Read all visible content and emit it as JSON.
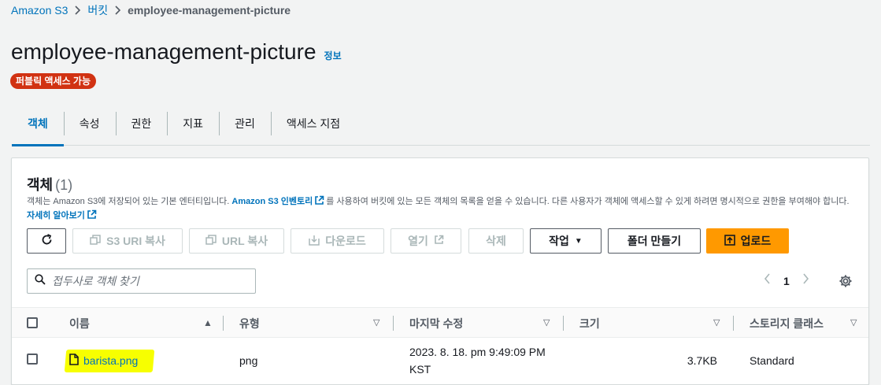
{
  "breadcrumb": {
    "items": [
      "Amazon S3",
      "버킷",
      "employee-management-picture"
    ]
  },
  "header": {
    "title": "employee-management-picture",
    "info_link": "정보",
    "badge": "퍼블릭 액세스 가능"
  },
  "tabs": [
    "객체",
    "속성",
    "권한",
    "지표",
    "관리",
    "액세스 지점"
  ],
  "objects": {
    "title": "객체",
    "count": "(1)",
    "description_1": "객체는 Amazon S3에 저장되어 있는 기본 엔터티입니다. ",
    "description_link_1": "Amazon S3 인벤토리",
    "description_2": "를 사용하여 버킷에 있는 모든 객체의 목록을 얻을 수 있습니다. 다른 사용자가 객체에 액세스할 수 있게 하려면 명시적으로 권한을 부여해야 합니다. ",
    "description_link_2": "자세히 알아보기"
  },
  "toolbar": {
    "copy_s3_uri": "S3 URI 복사",
    "copy_url": "URL 복사",
    "download": "다운로드",
    "open": "열기",
    "delete": "삭제",
    "actions": "작업",
    "create_folder": "폴더 만들기",
    "upload": "업로드"
  },
  "search": {
    "placeholder": "접두사로 객체 찾기"
  },
  "pagination": {
    "current_page": "1"
  },
  "table": {
    "columns": [
      "이름",
      "유형",
      "마지막 수정",
      "크기",
      "스토리지 클래스"
    ],
    "rows": [
      {
        "name": "barista.png",
        "type": "png",
        "modified_line1": "2023. 8. 18. pm 9:49:09 PM",
        "modified_line2": "KST",
        "size": "3.7KB",
        "storage_class": "Standard"
      }
    ]
  },
  "colors": {
    "link": "#0073bb",
    "badge": "#d13212",
    "primary_button": "#ff9900",
    "highlight": "#f7ff00"
  }
}
